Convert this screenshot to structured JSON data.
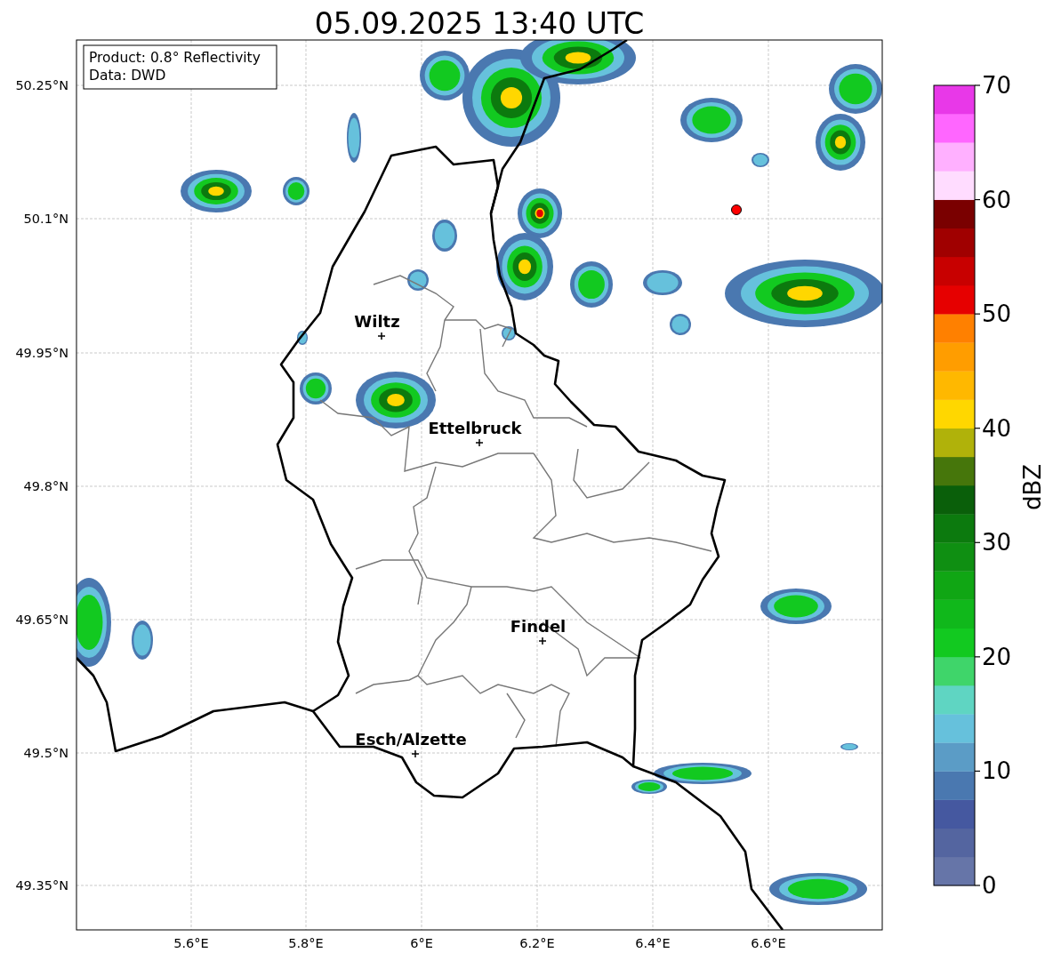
{
  "title": "05.09.2025 13:40 UTC",
  "info_box": [
    "Product: 0.8° Reflectivity",
    "Data: DWD"
  ],
  "y_ticks": [
    "50.25°N",
    "50.1°N",
    "49.95°N",
    "49.8°N",
    "49.65°N",
    "49.5°N",
    "49.35°N"
  ],
  "x_ticks": [
    "5.6°E",
    "5.8°E",
    "6°E",
    "6.2°E",
    "6.4°E",
    "6.6°E"
  ],
  "places": [
    {
      "name": "Wiltz"
    },
    {
      "name": "Ettelbruck"
    },
    {
      "name": "Findel"
    },
    {
      "name": "Esch/Alzette"
    }
  ],
  "colorbar": {
    "label": "dBZ",
    "ticks": [
      "70",
      "60",
      "50",
      "40",
      "30",
      "20",
      "10",
      "0"
    ],
    "segments": [
      {
        "color": "#6675a8"
      },
      {
        "color": "#5465a0"
      },
      {
        "color": "#4558a0"
      },
      {
        "color": "#4a78b0"
      },
      {
        "color": "#5b9cc6"
      },
      {
        "color": "#66c1dc"
      },
      {
        "color": "#5fd5c2"
      },
      {
        "color": "#3fd56a"
      },
      {
        "color": "#12c920"
      },
      {
        "color": "#10b81b"
      },
      {
        "color": "#10a614"
      },
      {
        "color": "#0f8f12"
      },
      {
        "color": "#0c7a0e"
      },
      {
        "color": "#0a5f0a"
      },
      {
        "color": "#46760b"
      },
      {
        "color": "#b0b20a"
      },
      {
        "color": "#ffd700"
      },
      {
        "color": "#ffb800"
      },
      {
        "color": "#ff9d00"
      },
      {
        "color": "#ff8000"
      },
      {
        "color": "#e60000"
      },
      {
        "color": "#c80000"
      },
      {
        "color": "#a00000"
      },
      {
        "color": "#7a0000"
      },
      {
        "color": "#ffdcff"
      },
      {
        "color": "#ffb0ff"
      },
      {
        "color": "#ff66ff"
      },
      {
        "color": "#e838e8"
      }
    ]
  }
}
